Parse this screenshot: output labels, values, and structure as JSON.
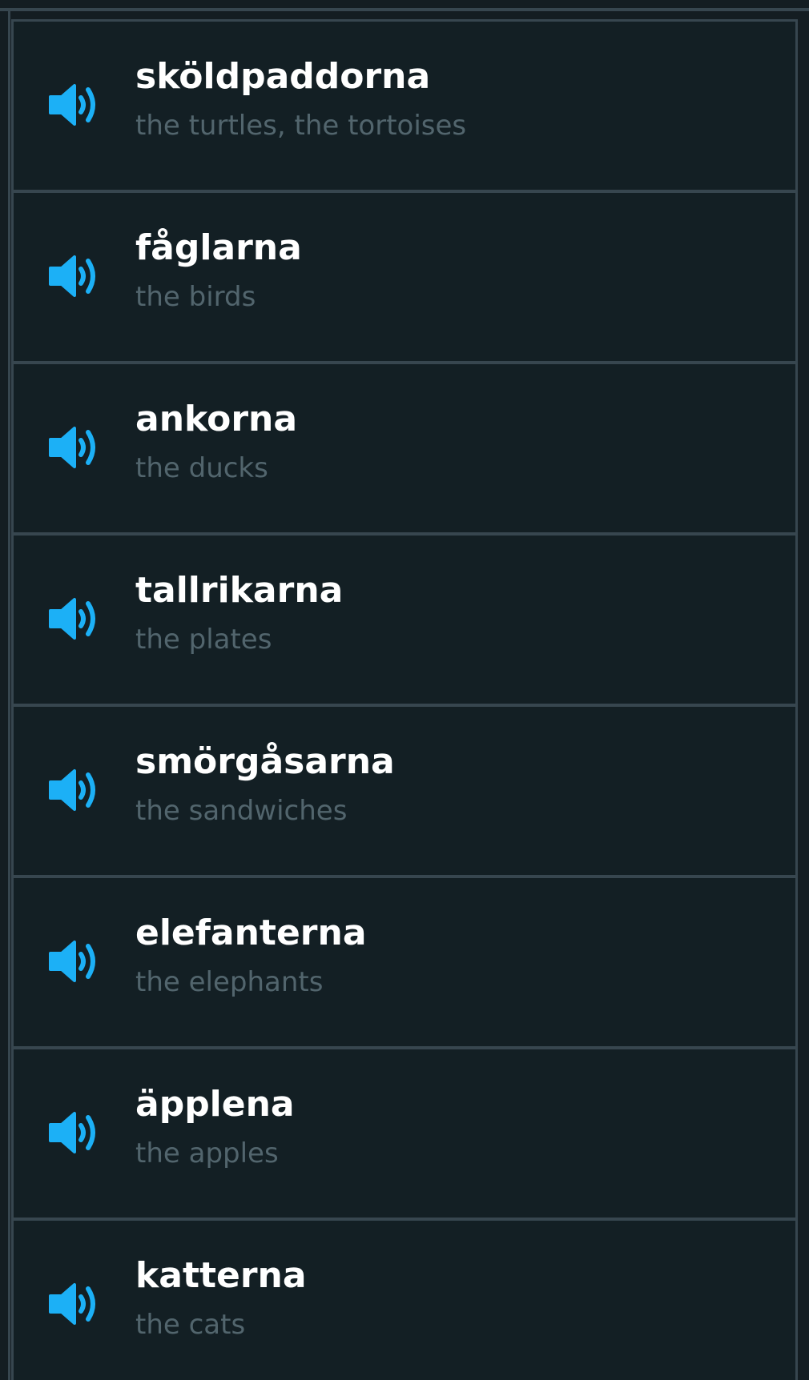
{
  "colors": {
    "background": "#131f24",
    "border": "#37464f",
    "term_text": "#ffffff",
    "translation_text": "#52656d",
    "speaker_icon": "#1cb0f6"
  },
  "icons": {
    "speaker": "speaker-icon"
  },
  "words": [
    {
      "term": "sköldpaddorna",
      "translation": "the turtles, the tortoises"
    },
    {
      "term": "fåglarna",
      "translation": "the birds"
    },
    {
      "term": "ankorna",
      "translation": "the ducks"
    },
    {
      "term": "tallrikarna",
      "translation": "the plates"
    },
    {
      "term": "smörgåsarna",
      "translation": "the sandwiches"
    },
    {
      "term": "elefanterna",
      "translation": "the elephants"
    },
    {
      "term": "äpplena",
      "translation": "the apples"
    },
    {
      "term": "katterna",
      "translation": "the cats"
    }
  ]
}
